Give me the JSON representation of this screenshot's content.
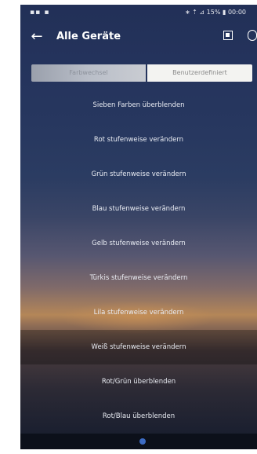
{
  "status_bar": {
    "left": "▪▪ ▪",
    "right": "∗ ⇡ ⊿ 15% ▮ 00:00"
  },
  "app_bar": {
    "title": "Alle Geräte"
  },
  "tabs": [
    {
      "label": "Farbwechsel"
    },
    {
      "label": "Benutzerdefiniert"
    }
  ],
  "list": [
    "Sieben Farben überblenden",
    "Rot stufenweise verändern",
    "Grün stufenweise verändern",
    "Blau stufenweise verändern",
    "Gelb stufenweise verändern",
    "Türkis stufenweise verändern",
    "Lila stufenweise verändern",
    "Weiß stufenweise verändern",
    "Rot/Grün überblenden",
    "Rot/Blau überblenden"
  ],
  "icons": {
    "back": "arrow-left-icon",
    "square": "stop-square-icon",
    "more": "overflow-icon"
  }
}
